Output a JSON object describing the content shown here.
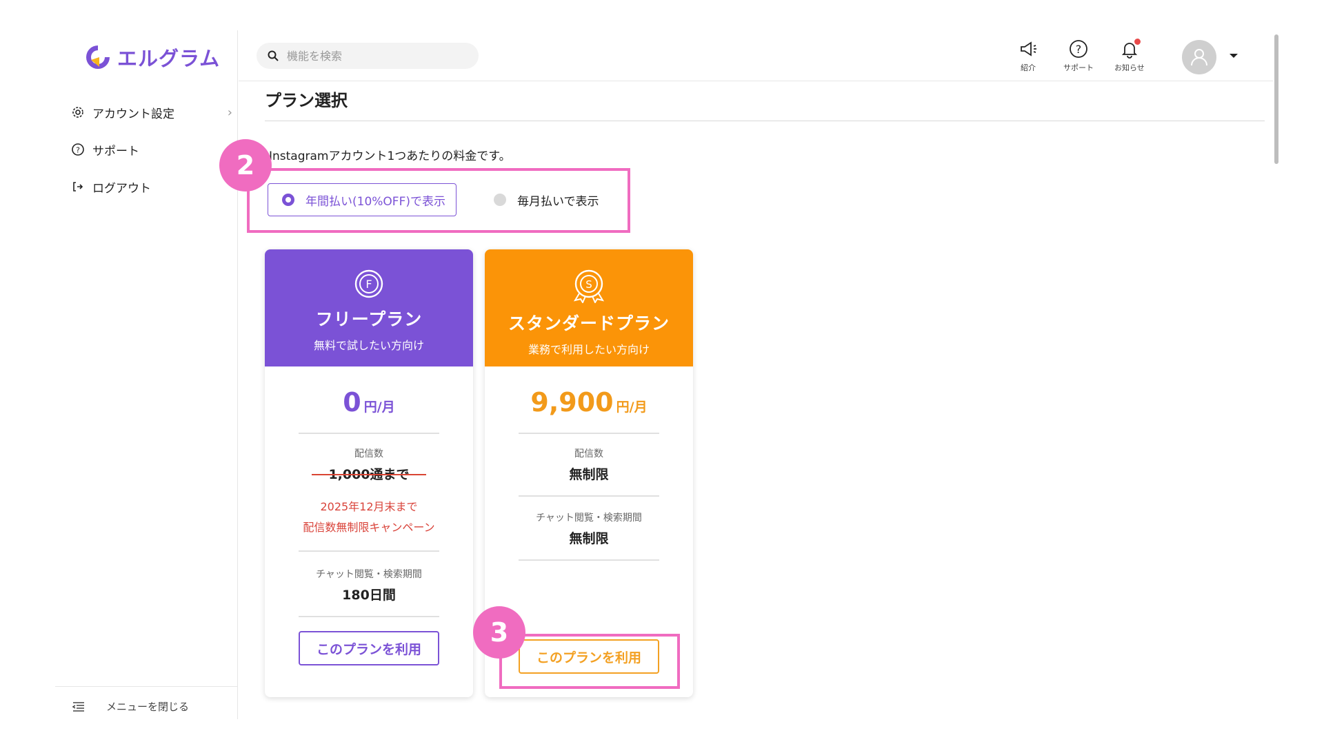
{
  "sidebar": {
    "logo_text": "エルグラム",
    "items": [
      {
        "label": "アカウント設定",
        "icon": "gear-icon"
      },
      {
        "label": "サポート",
        "icon": "question-circle-icon"
      },
      {
        "label": "ログアウト",
        "icon": "logout-icon"
      }
    ],
    "close_menu_label": "メニューを閉じる"
  },
  "header": {
    "search_placeholder": "機能を検索",
    "buttons": [
      {
        "label": "紹介",
        "icon": "megaphone-icon"
      },
      {
        "label": "サポート",
        "icon": "question-circle-icon"
      },
      {
        "label": "お知らせ",
        "icon": "bell-icon"
      }
    ]
  },
  "main": {
    "title": "プラン選択",
    "subtitle": "Instagramアカウント1つあたりの料金です。",
    "billing": {
      "annual_label": "年間払い(10%OFF)で表示",
      "monthly_label": "毎月払いで表示",
      "selected": "annual"
    },
    "badges": {
      "billing": "2",
      "standard_button": "3"
    },
    "plans": {
      "free": {
        "icon_letter": "F",
        "name": "フリープラン",
        "tagline": "無料で試したい方向け",
        "price": "0",
        "unit": "円/月",
        "delivery_label": "配信数",
        "delivery_value": "1,000通まで",
        "campaign_line1": "2025年12月末まで",
        "campaign_line2": "配信数無制限キャンペーン",
        "chat_label": "チャット閲覧・検索期間",
        "chat_value": "180日間",
        "button_label": "このプランを利用"
      },
      "standard": {
        "icon_letter": "S",
        "name": "スタンダードプラン",
        "tagline": "業務で利用したい方向け",
        "price": "9,900",
        "unit": "円/月",
        "delivery_label": "配信数",
        "delivery_value": "無制限",
        "chat_label": "チャット閲覧・検索期間",
        "chat_value": "無制限",
        "button_label": "このプランを利用"
      }
    }
  },
  "colors": {
    "brand_purple": "#7b52d6",
    "standard_orange": "#fb9408",
    "highlight_pink": "#f06cc0",
    "campaign_red": "#d9433a",
    "notification_dot": "#e84a4a"
  }
}
